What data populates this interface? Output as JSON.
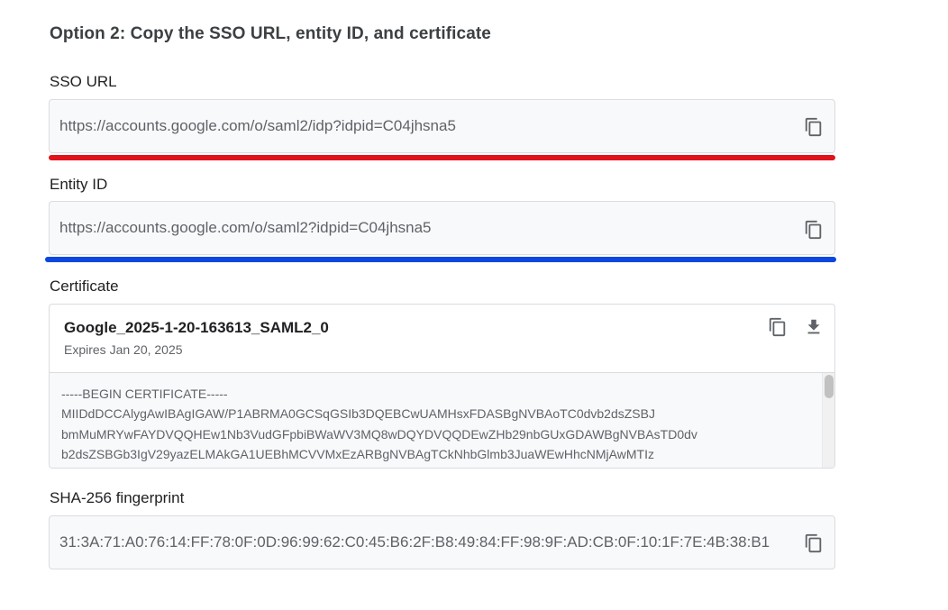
{
  "heading": "Option 2: Copy the SSO URL, entity ID, and certificate",
  "sso": {
    "label": "SSO URL",
    "value": "https://accounts.google.com/o/saml2/idp?idpid=C04jhsna5",
    "copy_icon": "copy-icon",
    "underline_color": "#e0121b"
  },
  "entity": {
    "label": "Entity ID",
    "value": "https://accounts.google.com/o/saml2?idpid=C04jhsna5",
    "copy_icon": "copy-icon",
    "underline_color": "#0b46e0"
  },
  "certificate": {
    "label": "Certificate",
    "name": "Google_2025-1-20-163613_SAML2_0",
    "expiry": "Expires Jan 20, 2025",
    "copy_icon": "copy-icon",
    "download_icon": "download-icon",
    "lines": [
      "-----BEGIN CERTIFICATE-----",
      "MIIDdDCCAlygAwIBAgIGAW/P1ABRMA0GCSqGSIb3DQEBCwUAMHsxFDASBgNVBAoTC0dvb2dsZSBJ",
      "bmMuMRYwFAYDVQQHEw1Nb3VudGFpbiBWaWV3MQ8wDQYDVQQDEwZHb29nbGUxGDAWBgNVBAsTD0dv",
      "b2dsZSBGb3IgV29yazELMAkGA1UEBhMCVVMxEzARBgNVBAgTCkNhbGlmb3JuaWEwHhcNMjAwMTIz"
    ]
  },
  "fingerprint": {
    "label": "SHA-256 fingerprint",
    "value": "31:3A:71:A0:76:14:FF:78:0F:0D:96:99:62:C0:45:B6:2F:B8:49:84:FF:98:9F:AD:CB:0F:10:1F:7E:4B:38:B1",
    "copy_icon": "copy-icon"
  }
}
